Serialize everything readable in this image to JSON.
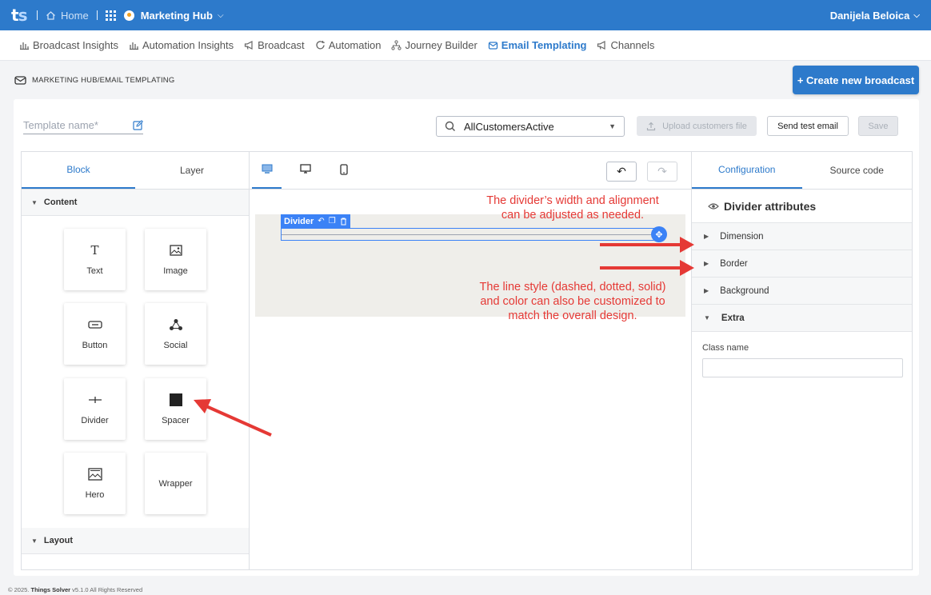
{
  "topbar": {
    "logo": "ts",
    "home": "Home",
    "hub": "Marketing Hub",
    "user": "Danijela Beloica"
  },
  "nav": [
    {
      "label": "Broadcast Insights",
      "icon": "bar-chart-icon"
    },
    {
      "label": "Automation Insights",
      "icon": "bar-chart-icon"
    },
    {
      "label": "Broadcast",
      "icon": "megaphone-icon"
    },
    {
      "label": "Automation",
      "icon": "refresh-icon"
    },
    {
      "label": "Journey Builder",
      "icon": "flow-icon"
    },
    {
      "label": "Email Templating",
      "icon": "email-template-icon"
    },
    {
      "label": "Channels",
      "icon": "megaphone-icon"
    }
  ],
  "breadcrumb": "MARKETING HUB/EMAIL TEMPLATING",
  "create_button": "+ Create new broadcast",
  "toolbar": {
    "template_name_placeholder": "Template name*",
    "audience": "AllCustomersActive",
    "upload": "Upload customers file",
    "send_test": "Send test email",
    "save": "Save"
  },
  "left_panel": {
    "tabs": [
      "Block",
      "Layer"
    ],
    "content_header": "Content",
    "layout_header": "Layout",
    "blocks": [
      {
        "label": "Text",
        "icon": "text-icon"
      },
      {
        "label": "Image",
        "icon": "image-icon"
      },
      {
        "label": "Button",
        "icon": "button-icon"
      },
      {
        "label": "Social",
        "icon": "social-icon"
      },
      {
        "label": "Divider",
        "icon": "divider-icon"
      },
      {
        "label": "Spacer",
        "icon": "spacer-icon"
      },
      {
        "label": "Hero",
        "icon": "hero-icon"
      },
      {
        "label": "Wrapper",
        "icon": ""
      }
    ]
  },
  "canvas": {
    "selected_label": "Divider"
  },
  "right_panel": {
    "tabs": [
      "Configuration",
      "Source code"
    ],
    "title": "Divider attributes",
    "sections": [
      "Dimension",
      "Border",
      "Background",
      "Extra"
    ],
    "class_label": "Class name"
  },
  "annotations": {
    "top": [
      "The divider’s width and alignment",
      "can be adjusted as needed."
    ],
    "bottom": [
      "The line style (dashed, dotted, solid)",
      "and color can also be customized to",
      "match the overall design."
    ]
  },
  "footer": {
    "prefix": "© 2025.",
    "company": "Things Solver",
    "suffix": "v5.1.0 All Rights Reserved"
  },
  "colors": {
    "primary": "#2d7acb",
    "selection": "#3b82f6",
    "annotation": "#e53935"
  }
}
